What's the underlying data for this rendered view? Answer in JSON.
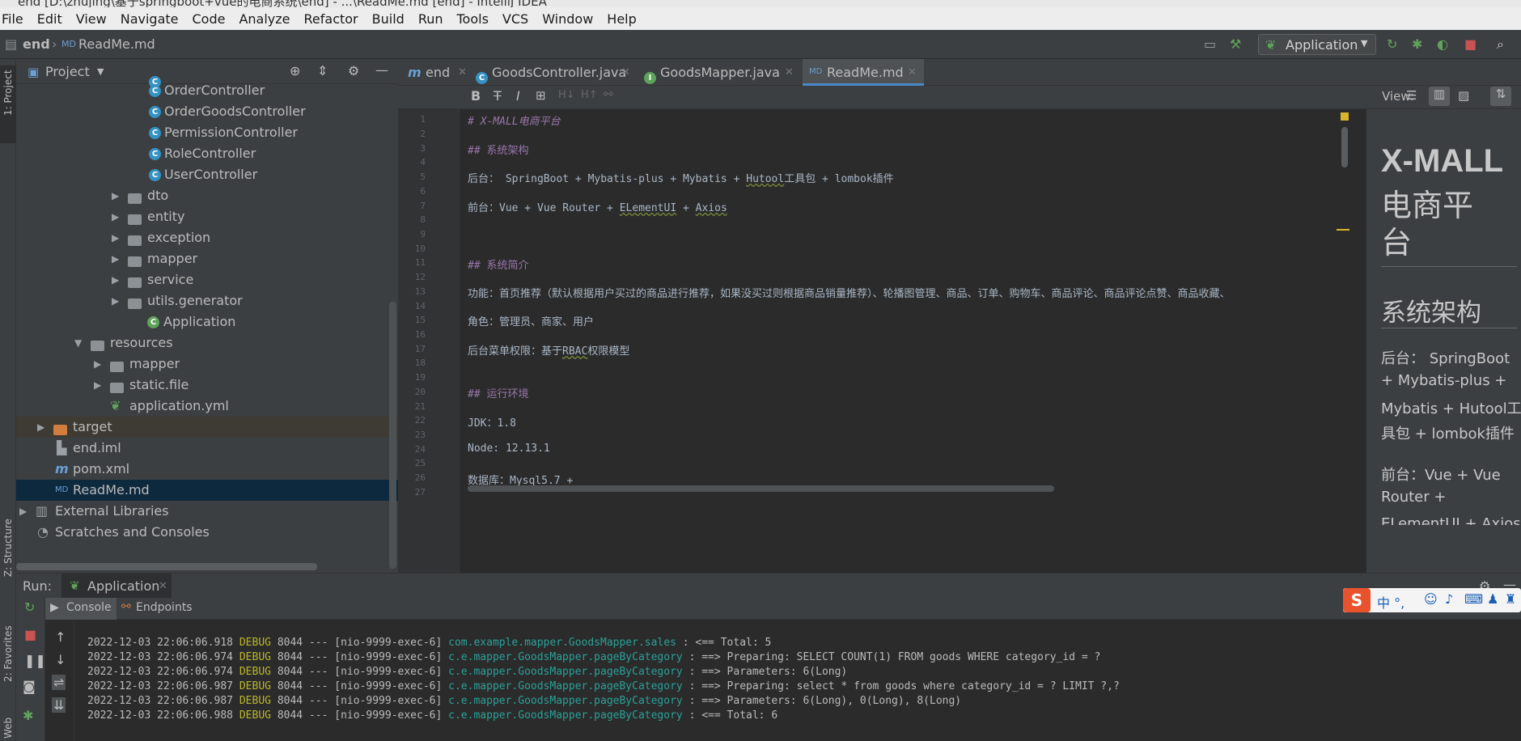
{
  "window": {
    "title": "end [D:\\zhujing\\基于springboot+vue的电商系统\\end] - ...\\ReadMe.md [end] - IntelliJ IDEA"
  },
  "menu": [
    "File",
    "Edit",
    "View",
    "Navigate",
    "Code",
    "Analyze",
    "Refactor",
    "Build",
    "Run",
    "Tools",
    "VCS",
    "Window",
    "Help"
  ],
  "nav": {
    "project": "end",
    "file": "ReadMe.md",
    "run_config": "Application"
  },
  "project_panel": {
    "title": "Project",
    "tree": [
      {
        "label": "OrderController",
        "kind": "class"
      },
      {
        "label": "OrderGoodsController",
        "kind": "class"
      },
      {
        "label": "PermissionController",
        "kind": "class"
      },
      {
        "label": "RoleController",
        "kind": "class"
      },
      {
        "label": "UserController",
        "kind": "class"
      },
      {
        "label": "dto",
        "kind": "package"
      },
      {
        "label": "entity",
        "kind": "package"
      },
      {
        "label": "exception",
        "kind": "package"
      },
      {
        "label": "mapper",
        "kind": "package"
      },
      {
        "label": "service",
        "kind": "package"
      },
      {
        "label": "utils.generator",
        "kind": "package"
      },
      {
        "label": "Application",
        "kind": "app"
      },
      {
        "label": "resources",
        "kind": "folder"
      },
      {
        "label": "mapper",
        "kind": "folder"
      },
      {
        "label": "static.file",
        "kind": "folder"
      },
      {
        "label": "application.yml",
        "kind": "yml"
      },
      {
        "label": "target",
        "kind": "folder"
      },
      {
        "label": "end.iml",
        "kind": "iml"
      },
      {
        "label": "pom.xml",
        "kind": "maven"
      },
      {
        "label": "ReadMe.md",
        "kind": "md"
      },
      {
        "label": "External Libraries",
        "kind": "lib"
      },
      {
        "label": "Scratches and Consoles",
        "kind": "scratch"
      }
    ]
  },
  "side_labels": {
    "project": "1: Project",
    "structure": "Z: Structure",
    "favorites": "2: Favorites",
    "web": "Web"
  },
  "editor_tabs": [
    "end",
    "GoodsController.java",
    "GoodsMapper.java",
    "ReadMe.md"
  ],
  "md_toolbar": {
    "view_label": "View:"
  },
  "code_lines": {
    "l1": "# X-MALL电商平台",
    "l3": "## 系统架构",
    "l5a": "后台： SpringBoot + Mybatis-plus + Mybatis + ",
    "l5b": "Hutool",
    "l5c": "工具包 + lombok插件",
    "l7a": "前台：Vue + Vue Router + ",
    "l7b": "ELementUI",
    "l7c": " + ",
    "l7d": "Axios",
    "l11": "## 系统简介",
    "l13": "功能：首页推荐（默认根据用户买过的商品进行推荐，如果没买过则根据商品销量推荐）、轮播图管理、商品、订单、购物车、商品评论、商品评论点赞、商品收藏、",
    "l15": "角色：管理员、商家、用户",
    "l17a": "后台菜单权限：基于",
    "l17b": "RBAC",
    "l17c": "权限模型",
    "l20": "## 运行环境",
    "l22": "JDK：1.8",
    "l24": "Node:  12.13.1",
    "l26": "数据库：Mysql5.7 +"
  },
  "line_numbers": [
    "1",
    "2",
    "3",
    "4",
    "5",
    "6",
    "7",
    "8",
    "9",
    "10",
    "11",
    "12",
    "13",
    "14",
    "15",
    "16",
    "17",
    "18",
    "19",
    "20",
    "21",
    "22",
    "23",
    "24",
    "25",
    "26",
    "27"
  ],
  "preview": {
    "h1a": "X-MALL",
    "h1b": "电商平",
    "h1c": "台",
    "h2": "系统架构",
    "p1a": "后台： SpringBoot",
    "p1b": "+ Mybatis-plus +",
    "p1c": "Mybatis + Hutool工",
    "p1d": "具包 + lombok插件",
    "p2a": "前台：Vue + Vue",
    "p2b": "Router +",
    "p2c": "ELementUI + Axios"
  },
  "run": {
    "label": "Run:",
    "tab": "Application",
    "console_tab": "Console",
    "endpoints_tab": "Endpoints",
    "log": [
      {
        "ts": "2022-12-03 22:06:06.918",
        "level": "DEBUG",
        "pid": "8044",
        "sep": "---",
        "thread": "[nio-9999-exec-6]",
        "logger": "com.example.mapper.GoodsMapper.sales",
        "msg": ": <==      Total: 5"
      },
      {
        "ts": "2022-12-03 22:06:06.974",
        "level": "DEBUG",
        "pid": "8044",
        "sep": "---",
        "thread": "[nio-9999-exec-6]",
        "logger": "c.e.mapper.GoodsMapper.pageByCategory",
        "msg": ": ==>  Preparing: SELECT COUNT(1) FROM goods WHERE category_id = ?"
      },
      {
        "ts": "2022-12-03 22:06:06.974",
        "level": "DEBUG",
        "pid": "8044",
        "sep": "---",
        "thread": "[nio-9999-exec-6]",
        "logger": "c.e.mapper.GoodsMapper.pageByCategory",
        "msg": ": ==> Parameters: 6(Long)"
      },
      {
        "ts": "2022-12-03 22:06:06.987",
        "level": "DEBUG",
        "pid": "8044",
        "sep": "---",
        "thread": "[nio-9999-exec-6]",
        "logger": "c.e.mapper.GoodsMapper.pageByCategory",
        "msg": ": ==>  Preparing: select * from goods where category_id = ? LIMIT ?,?"
      },
      {
        "ts": "2022-12-03 22:06:06.987",
        "level": "DEBUG",
        "pid": "8044",
        "sep": "---",
        "thread": "[nio-9999-exec-6]",
        "logger": "c.e.mapper.GoodsMapper.pageByCategory",
        "msg": ": ==> Parameters: 6(Long), 0(Long), 8(Long)"
      },
      {
        "ts": "2022-12-03 22:06:06.988",
        "level": "DEBUG",
        "pid": "8044",
        "sep": "---",
        "thread": "[nio-9999-exec-6]",
        "logger": "c.e.mapper.GoodsMapper.pageByCategory",
        "msg": ": <==      Total: 6"
      }
    ]
  },
  "ime": {
    "logo": "S",
    "text": "中 °,"
  },
  "colors": {
    "accent": "#3592c4",
    "debug": "#bbb529",
    "logger": "#2aa198",
    "selection": "#0d293e"
  }
}
